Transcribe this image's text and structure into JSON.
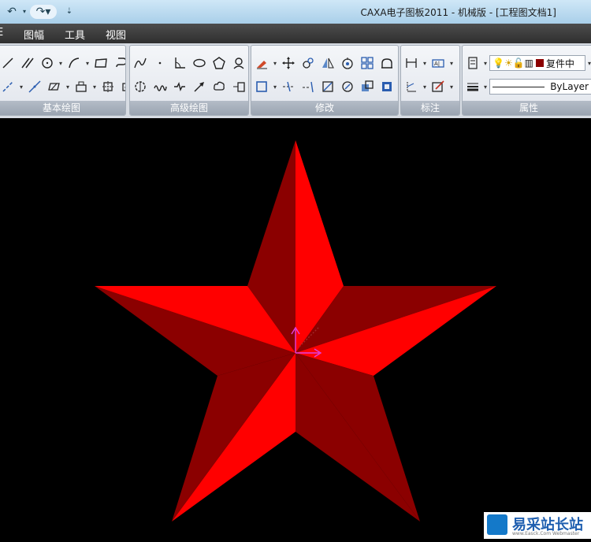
{
  "window": {
    "title": "CAXA电子图板2011 - 机械版 - [工程图文档1]"
  },
  "quick_access": {
    "undo_icon": "undo-icon",
    "redo_icon": "redo-icon",
    "menu_icon": "customize-icon"
  },
  "menu": {
    "partial": "E",
    "items": [
      "图幅",
      "工具",
      "视图"
    ]
  },
  "ribbon": {
    "groups": [
      {
        "label": "基本绘图"
      },
      {
        "label": "高级绘图"
      },
      {
        "label": "修改"
      },
      {
        "label": "标注"
      },
      {
        "label": "属性"
      }
    ],
    "properties": {
      "layer_value": "复件中",
      "linetype_value": "ByLayer"
    }
  },
  "watermark": {
    "text": "易采站长站",
    "sub": "www.Easck.Com Webmaster"
  },
  "colors": {
    "star_light": "#ff0000",
    "star_dark": "#8b0000",
    "background": "#000000",
    "ucs": "#e040e0"
  }
}
